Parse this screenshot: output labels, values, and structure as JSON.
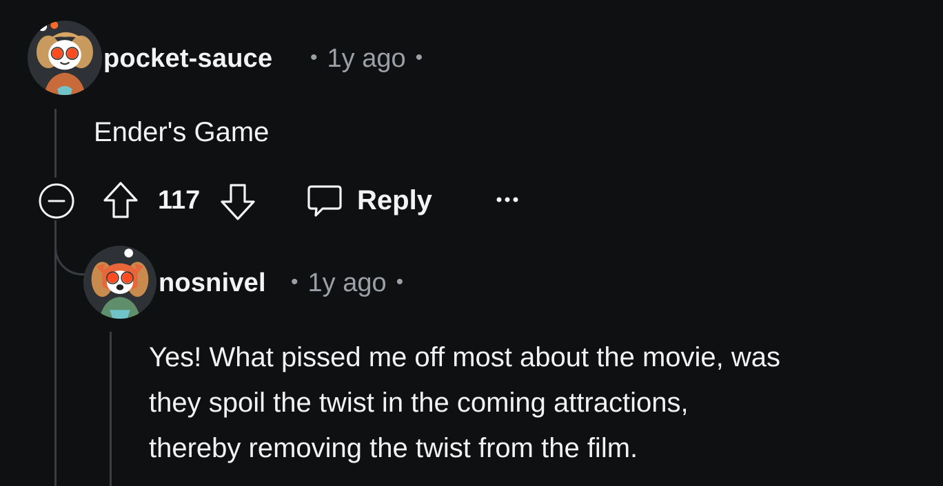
{
  "comments": [
    {
      "username": "pocket-sauce",
      "age": "1y ago",
      "body": "Ender's Game",
      "score": "117",
      "reply_label": "Reply",
      "more_label": "..."
    },
    {
      "username": "nosnivel",
      "age": "1y ago",
      "body_lines": [
        "Yes! What pissed me off most about the movie, was",
        "they spoil the twist in the coming attractions,",
        "thereby removing the twist from the film."
      ]
    }
  ],
  "icons": {
    "collapse": "collapse-minus-icon",
    "upvote": "upvote-arrow-icon",
    "downvote": "downvote-arrow-icon",
    "reply": "comment-bubble-icon",
    "more": "more-options-icon"
  },
  "colors": {
    "background": "#0f1012",
    "text": "#f2f3f5",
    "meta": "#9ca0a6",
    "thread_line": "#3a3d42"
  }
}
